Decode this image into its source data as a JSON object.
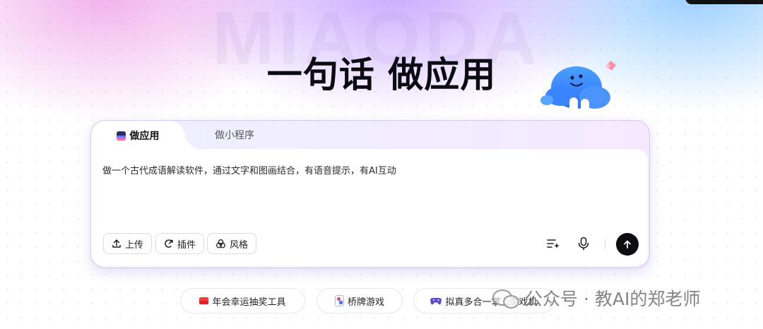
{
  "hero": {
    "watermark": "MIAODA",
    "title": "一句话 做应用"
  },
  "tabs": [
    {
      "label": "做应用",
      "active": true
    },
    {
      "label": "做小程序",
      "active": false
    }
  ],
  "prompt": {
    "value": "做一个古代成语解读软件，通过文字和图画结合，有语音提示，有AI互动"
  },
  "tools": {
    "upload_label": "上传",
    "plugin_label": "插件",
    "style_label": "风格"
  },
  "icons": {
    "list_sparkle": "list-sparkle-icon",
    "mic": "mic-icon",
    "send": "arrow-up-icon"
  },
  "suggestions": [
    {
      "label": "年会幸运抽奖工具",
      "icon": "red-envelope-icon"
    },
    {
      "label": "桥牌游戏",
      "icon": "playing-card-icon"
    },
    {
      "label": "拟真多合一掌上游戏机",
      "icon": "gamepad-icon"
    }
  ],
  "watermark_overlay": {
    "text": "公众号 · 教AI的郑老师"
  },
  "colors": {
    "accent": "#6e74ff",
    "send_button": "#0d0d12",
    "title": "#0b0b12"
  }
}
